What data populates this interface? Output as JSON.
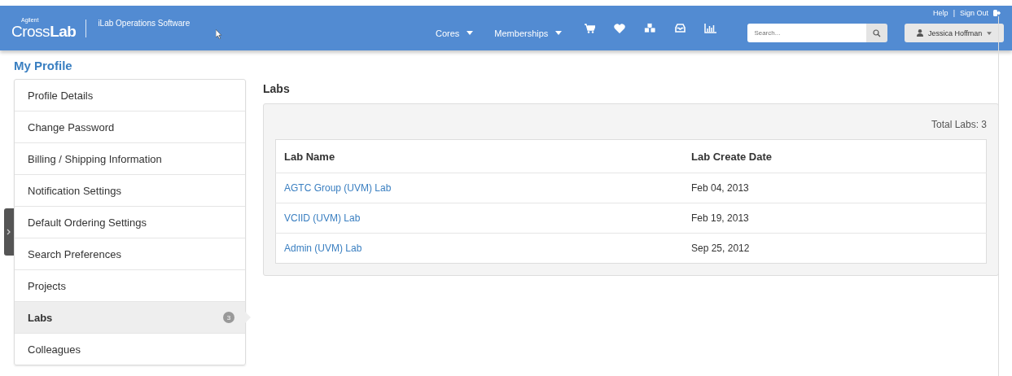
{
  "header": {
    "logo_brand": "Agilent",
    "logo": "Cross**Lab**",
    "app_name": "iLab Operations Software",
    "nav": [
      {
        "label": "Cores",
        "dropdown": true
      },
      {
        "label": "Memberships",
        "dropdown": true
      }
    ],
    "top_links": [
      "Help",
      "Sign Out"
    ],
    "link_separator": "|",
    "search": {
      "placeholder": "Search..."
    },
    "user": "Jessica Hoffman"
  },
  "page_title": "My Profile",
  "sidebar": {
    "items": [
      {
        "label": "Profile Details",
        "selected": false
      },
      {
        "label": "Change Password",
        "selected": false
      },
      {
        "label": "Billing / Shipping Information",
        "selected": false
      },
      {
        "label": "Notification Settings",
        "selected": false
      },
      {
        "label": "Default Ordering Settings",
        "selected": false
      },
      {
        "label": "Search Preferences",
        "selected": false
      },
      {
        "label": "Projects",
        "selected": false
      },
      {
        "label": "Labs",
        "selected": true,
        "badge": "3"
      },
      {
        "label": "Colleagues",
        "selected": false
      }
    ]
  },
  "content": {
    "title": "Labs",
    "total": "Total Labs: 3",
    "table": {
      "columns": [
        "Lab Name",
        "Lab Create Date"
      ],
      "rows": [
        [
          "AGTC Group (UVM) Lab",
          "Feb 04, 2013"
        ],
        [
          "VCIID (UVM) Lab",
          "Feb 19, 2013"
        ],
        [
          "Admin (UVM) Lab",
          "Sep 25, 2012"
        ]
      ]
    }
  }
}
